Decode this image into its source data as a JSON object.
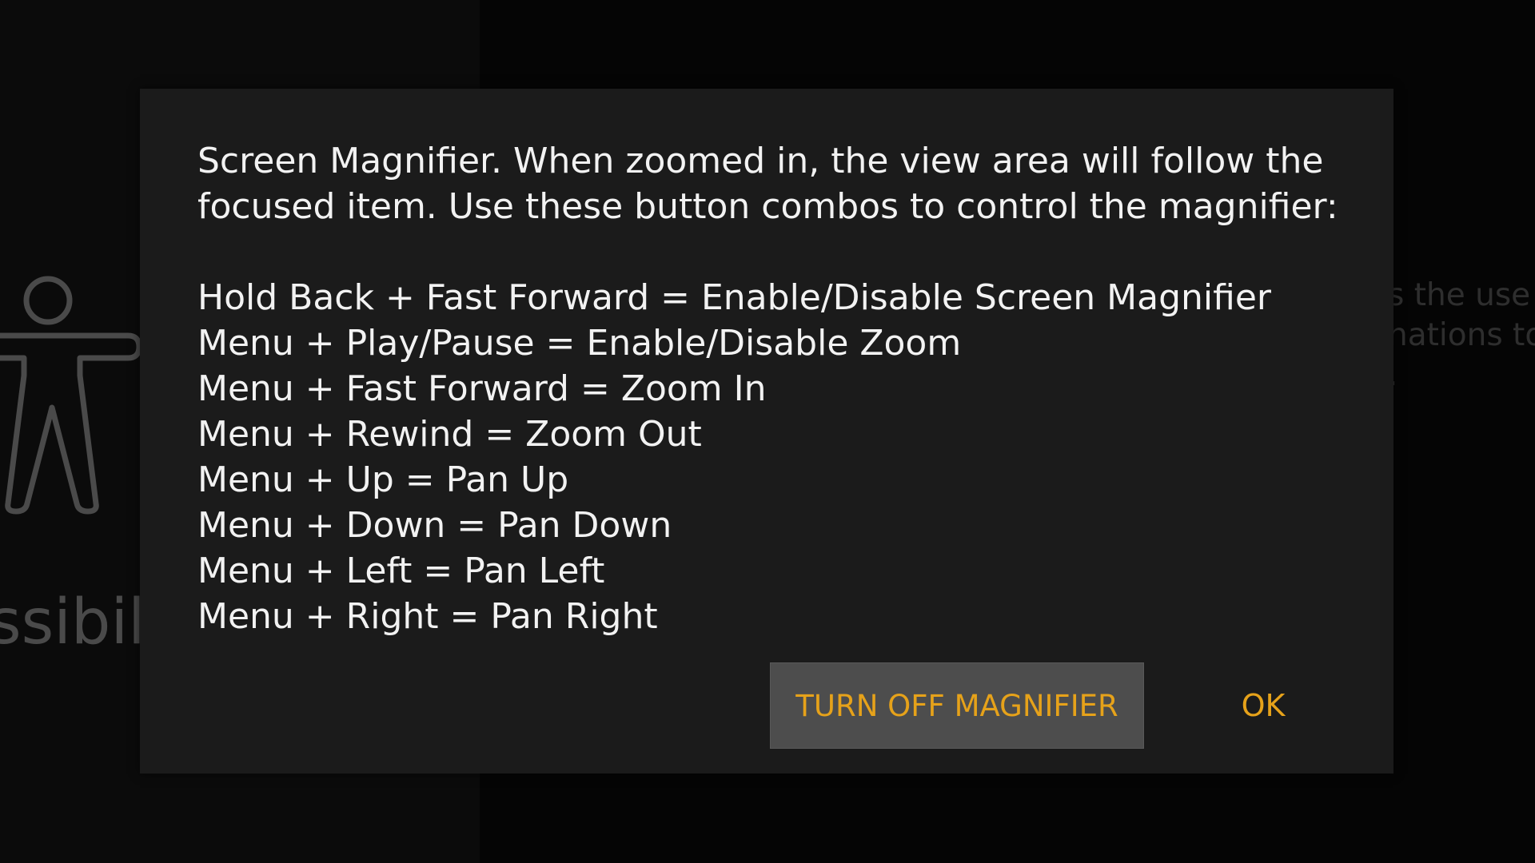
{
  "background": {
    "category_label": "essibil",
    "description_lines": [
      "s the use",
      "nations to",
      "."
    ]
  },
  "dialog": {
    "intro_lines": [
      "Screen Magnifier. When zoomed in, the view area will follow the",
      "focused item. Use these button combos to control the magnifier:"
    ],
    "combos": [
      "Hold Back + Fast Forward = Enable/Disable Screen Magnifier",
      "Menu + Play/Pause = Enable/Disable Zoom",
      "Menu + Fast Forward = Zoom In",
      "Menu + Rewind = Zoom Out",
      "Menu + Up = Pan Up",
      "Menu + Down = Pan Down",
      "Menu + Left = Pan Left",
      "Menu + Right = Pan Right"
    ],
    "buttons": {
      "turn_off_label": "TURN OFF MAGNIFIER",
      "ok_label": "OK"
    }
  },
  "colors": {
    "accent": "#e6a21a",
    "dialog_bg": "#1b1b1b",
    "focused_button_bg": "#4d4d4d",
    "text": "#f2f2f2"
  },
  "icons": {
    "background_icon": "accessibility-person-icon"
  }
}
